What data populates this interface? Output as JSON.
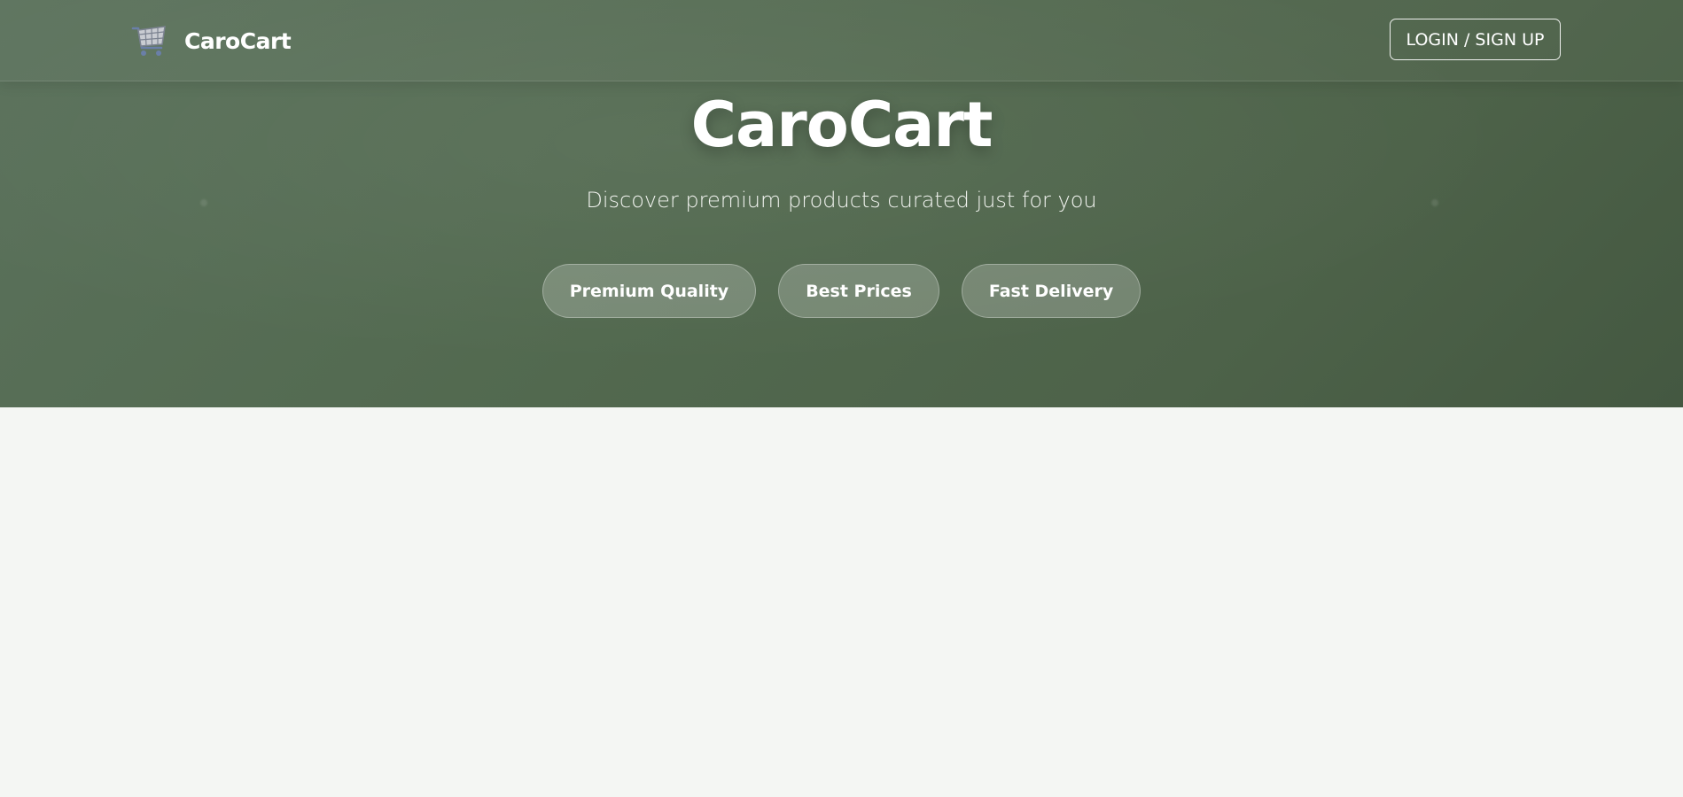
{
  "colors": {
    "hero_background": "#52694f",
    "page_background": "#f4f6f3",
    "text_on_hero": "#ffffff"
  },
  "navbar": {
    "logo_icon": "shopping-cart-icon",
    "brand_name": "CaroCart",
    "login_label": "LOGIN / SIGN UP"
  },
  "hero": {
    "title": "CaroCart",
    "subtitle": "Discover premium products curated just for you",
    "features": [
      {
        "label": "Premium Quality"
      },
      {
        "label": "Best Prices"
      },
      {
        "label": "Fast Delivery"
      }
    ]
  }
}
